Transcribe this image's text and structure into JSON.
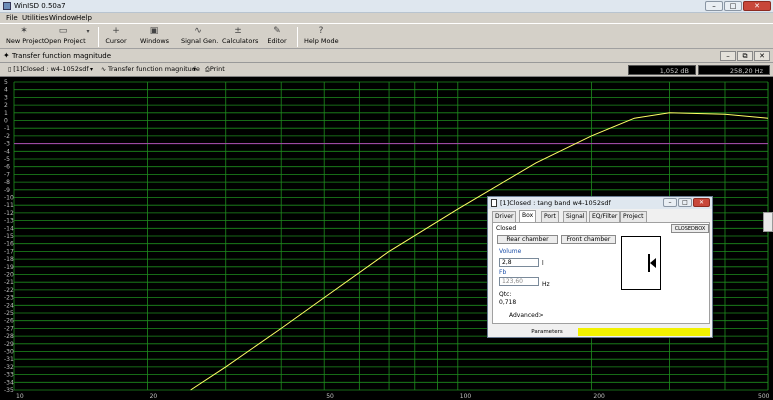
{
  "app": {
    "title": "WinISD 0.50a7"
  },
  "menu": [
    "File",
    "Utilities",
    "Window",
    "Help"
  ],
  "toolbar": [
    {
      "label": "New Project",
      "icon": "new-project-icon",
      "glyph": "✶"
    },
    {
      "label": "Open Project",
      "icon": "open-project-icon",
      "glyph": "▭"
    },
    {
      "label": "Cursor",
      "icon": "cursor-icon",
      "glyph": "+"
    },
    {
      "label": "Windows",
      "icon": "windows-icon",
      "glyph": "▣"
    },
    {
      "label": "Signal Gen.",
      "icon": "signal-gen-icon",
      "glyph": "∿"
    },
    {
      "label": "Calculators",
      "icon": "calculators-icon",
      "glyph": "±"
    },
    {
      "label": "Editor",
      "icon": "editor-icon",
      "glyph": "✎"
    },
    {
      "label": "Help Mode",
      "icon": "help-mode-icon",
      "glyph": "?"
    }
  ],
  "mdi": {
    "title": "Transfer function magnitude",
    "project_select": "[1]Closed : w4-1052sdf",
    "graph_select": "Transfer function magnitude",
    "print_label": "Print",
    "readout_db": "1,052 dB",
    "readout_hz": "258,20 Hz"
  },
  "chart_data": {
    "type": "line",
    "xlabel": "",
    "ylabel": "",
    "x_scale": "log",
    "xlim": [
      10,
      500
    ],
    "ylim": [
      -35,
      5
    ],
    "x_ticks": [
      "10",
      "20",
      "50",
      "100",
      "200",
      "500"
    ],
    "y_ticks": [
      "5",
      "4",
      "3",
      "2",
      "1",
      "0",
      "-1",
      "-2",
      "-3",
      "-4",
      "-5",
      "-6",
      "-7",
      "-8",
      "-9",
      "-10",
      "-11",
      "-12",
      "-13",
      "-14",
      "-15",
      "-16",
      "-17",
      "-18",
      "-19",
      "-20",
      "-21",
      "-22",
      "-23",
      "-24",
      "-25",
      "-26",
      "-27",
      "-28",
      "-29",
      "-30",
      "-31",
      "-32",
      "-33",
      "-34",
      "-35"
    ],
    "reference_line_db": -3,
    "grid": true,
    "series": [
      {
        "color": "#ffff66",
        "x": [
          25,
          30,
          40,
          50,
          70,
          100,
          150,
          200,
          250,
          300,
          400,
          500
        ],
        "y": [
          -35,
          -32,
          -27,
          -23,
          -17,
          -11.5,
          -5.5,
          -2,
          0.3,
          1,
          0.8,
          0.3
        ]
      }
    ]
  },
  "dialog": {
    "title": "[1]Closed : tang band w4-1052sdf",
    "tabs": [
      "Driver",
      "Box",
      "Port",
      "Signal",
      "EQ/Filter",
      "Project"
    ],
    "active_tab": "Box",
    "type_label": "Closed",
    "type_button": "CLOSEDBOX",
    "rear_button": "Rear chamber",
    "front_button": "Front chamber",
    "volume_label": "Volume",
    "volume_value": "2,8",
    "volume_unit": "l",
    "fb_label": "Fb",
    "fb_value": "123,60",
    "fb_unit": "Hz",
    "qtc_label": "Qtc:",
    "qtc_value": "0,718",
    "advanced_label": "Advanced>",
    "status_label": "Parameters"
  }
}
